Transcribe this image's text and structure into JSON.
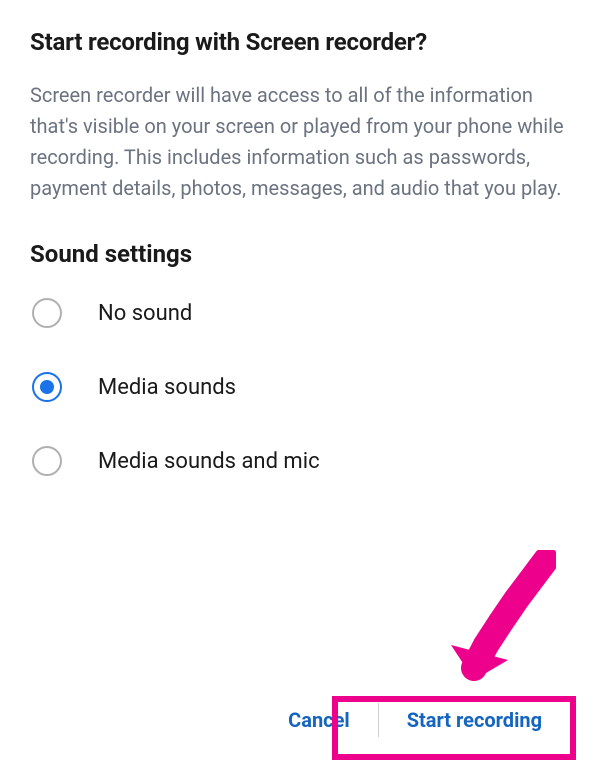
{
  "dialog": {
    "title": "Start recording with Screen recorder?",
    "description": "Screen recorder will have access to all of the information that's visible on your screen or played from your phone while recording. This includes information such as passwords, payment details, photos, messages, and audio that you play."
  },
  "soundSettings": {
    "heading": "Sound settings",
    "options": [
      {
        "label": "No sound",
        "selected": false
      },
      {
        "label": "Media sounds",
        "selected": true
      },
      {
        "label": "Media sounds and mic",
        "selected": false
      }
    ]
  },
  "buttons": {
    "cancel": "Cancel",
    "confirm": "Start recording"
  },
  "colors": {
    "accent": "#1565c0",
    "annotation": "#ec008c",
    "text": "#1a1a1a",
    "muted": "#6b7280"
  }
}
